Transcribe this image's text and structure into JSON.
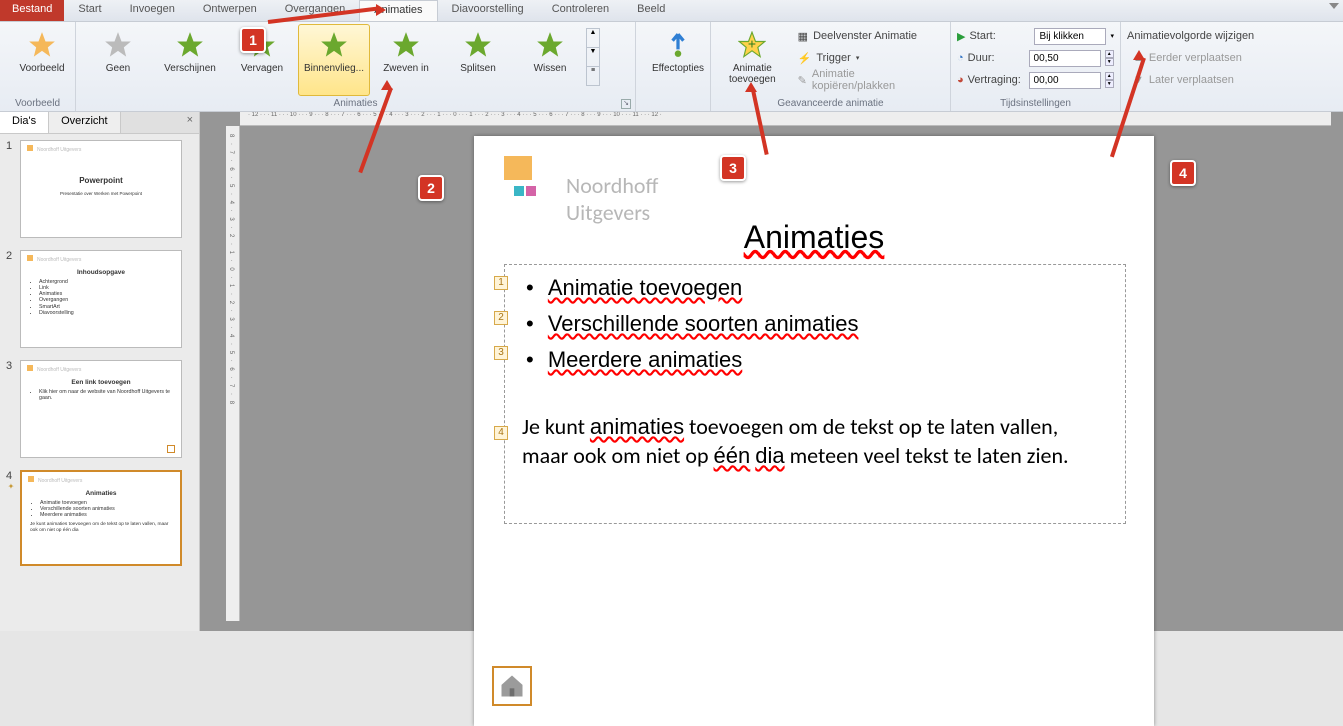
{
  "menubar": {
    "file": "Bestand",
    "items": [
      {
        "label": "Start"
      },
      {
        "label": "Invoegen"
      },
      {
        "label": "Ontwerpen"
      },
      {
        "label": "Overgangen"
      },
      {
        "label": "Animaties",
        "active": true
      },
      {
        "label": "Diavoorstelling"
      },
      {
        "label": "Controleren"
      },
      {
        "label": "Beeld"
      }
    ]
  },
  "ribbon": {
    "preview": {
      "label": "Voorbeeld",
      "group": "Voorbeeld"
    },
    "anim_items": [
      {
        "label": "Geen",
        "icon": "none"
      },
      {
        "label": "Verschijnen",
        "icon": "star"
      },
      {
        "label": "Vervagen",
        "icon": "star"
      },
      {
        "label": "Binnenvlieg...",
        "icon": "star",
        "selected": true
      },
      {
        "label": "Zweven in",
        "icon": "star"
      },
      {
        "label": "Splitsen",
        "icon": "star"
      },
      {
        "label": "Wissen",
        "icon": "star"
      }
    ],
    "anim_group": "Animaties",
    "effect_opts": {
      "label": "Effectopties"
    },
    "add_anim": {
      "label": "Animatie\ntoevoegen"
    },
    "adv": {
      "pane": "Deelvenster Animatie",
      "trigger": "Trigger",
      "painter": "Animatie kopiëren/plakken",
      "group": "Geavanceerde animatie"
    },
    "timing": {
      "start_lbl": "Start:",
      "start_val": "Bij klikken",
      "dur_lbl": "Duur:",
      "dur_val": "00,50",
      "delay_lbl": "Vertraging:",
      "delay_val": "00,00",
      "group": "Tijdsinstellingen"
    },
    "reorder": {
      "title": "Animatievolgorde wijzigen",
      "up": "Eerder verplaatsen",
      "down": "Later verplaatsen"
    }
  },
  "left": {
    "tab_slides": "Dia's",
    "tab_outline": "Overzicht",
    "thumbs": [
      {
        "n": "1",
        "title": "Powerpoint",
        "sub": "Presentatie over Werken met Powerpoint"
      },
      {
        "n": "2",
        "title": "Inhoudsopgave",
        "bullets": [
          "Achtergrond",
          "Link",
          "Animaties",
          "Overgangen",
          "SmartArt",
          "Diavoorstelling"
        ]
      },
      {
        "n": "3",
        "title": "Een link toevoegen",
        "bullets": [
          "Klik hier om naar de website van Noordhoff Uitgevers te gaan."
        ]
      },
      {
        "n": "4",
        "title": "Animaties",
        "selected": true,
        "bullets": [
          "Animatie toevoegen",
          "Verschillende soorten animaties",
          "Meerdere animaties"
        ],
        "extra": "Je kunt animaties toevoegen om de tekst op te laten vallen, maar ook om niet op één dia"
      }
    ],
    "logo_txt": "Noordhoff Uitgevers"
  },
  "slide": {
    "logo": "Noordhoff Uitgevers",
    "title": "Animaties",
    "bullets": [
      "Animatie toevoegen",
      "Verschillende soorten animaties",
      "Meerdere animaties"
    ],
    "para": "Je kunt animaties toevoegen om de tekst op te laten vallen, maar ook om niet op één dia meteen veel tekst te laten zien.",
    "tags": [
      "1",
      "2",
      "3",
      "4"
    ]
  },
  "callouts": {
    "c1": "1",
    "c2": "2",
    "c3": "3",
    "c4": "4"
  }
}
